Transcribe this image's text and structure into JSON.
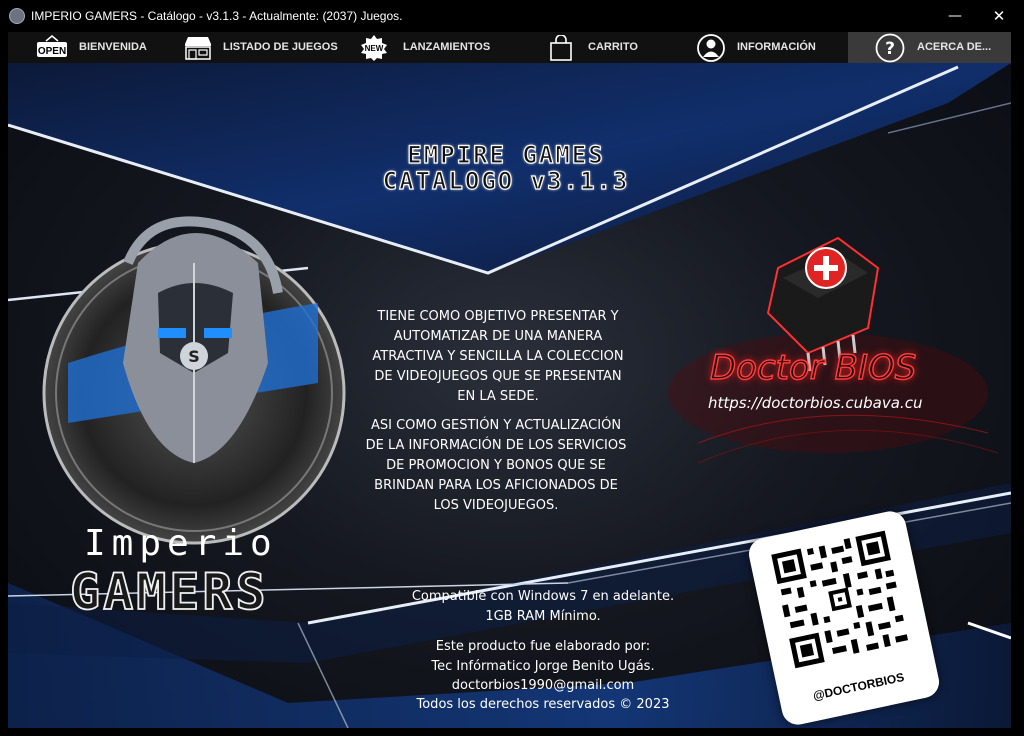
{
  "window": {
    "title": "IMPERIO GAMERS - Catálogo - v3.1.3 - Actualmente: (2037) Juegos.",
    "minimize_glyph": "—",
    "close_glyph": "✕"
  },
  "nav": {
    "items": [
      {
        "label": "BIENVENIDA",
        "icon": "open-sign-icon",
        "badge": "OPEN"
      },
      {
        "label": "LISTADO DE JUEGOS",
        "icon": "store-icon"
      },
      {
        "label": "LANZAMIENTOS",
        "icon": "new-badge-icon",
        "badge": "NEW"
      },
      {
        "label": "CARRITO",
        "icon": "shopping-bag-icon"
      },
      {
        "label": "INFORMACIÓN",
        "icon": "person-icon"
      },
      {
        "label": "ACERCA DE...",
        "icon": "question-icon",
        "active": true
      }
    ]
  },
  "header": {
    "line1": "EMPIRE GAMES",
    "line2": "CATALOGO v3.1.3"
  },
  "description": {
    "p1": [
      "TIENE COMO OBJETIVO PRESENTAR Y",
      "AUTOMATIZAR DE UNA MANERA",
      "ATRACTIVA Y SENCILLA  LA COLECCION",
      "DE VIDEOJUEGOS QUE SE PRESENTAN",
      "EN LA SEDE."
    ],
    "p2": [
      "ASI COMO GESTIÓN Y ACTUALIZACIÓN",
      "DE LA INFORMACIÓN DE LOS SERVICIOS",
      "DE PROMOCION Y BONOS QUE SE",
      "BRINDAN PARA LOS AFICIONADOS DE",
      "LOS VIDEOJUEGOS."
    ]
  },
  "requirements": {
    "line1": "Compatible con Windows 7 en adelante.",
    "line2": "1GB RAM Mínimo."
  },
  "credits": {
    "line1": "Este producto fue elaborado por:",
    "line2": "Tec Infórmatico Jorge Benito Ugás.",
    "line3": "doctorbios1990@gmail.com",
    "line4": "Todos los derechos reservados © 2023"
  },
  "brand": {
    "line1": "Imperio",
    "line2": "GAMERS",
    "emblem_letter": "S"
  },
  "doctor": {
    "title": "Doctor BIOS",
    "url": "https://doctorbios.cubava.cu"
  },
  "qr": {
    "handle": "@DOCTORBIOS"
  },
  "colors": {
    "accent_blue": "#1f6fd1",
    "accent_red": "#e02424",
    "nav_bg": "#111111",
    "nav_active": "#3a3a3a"
  }
}
